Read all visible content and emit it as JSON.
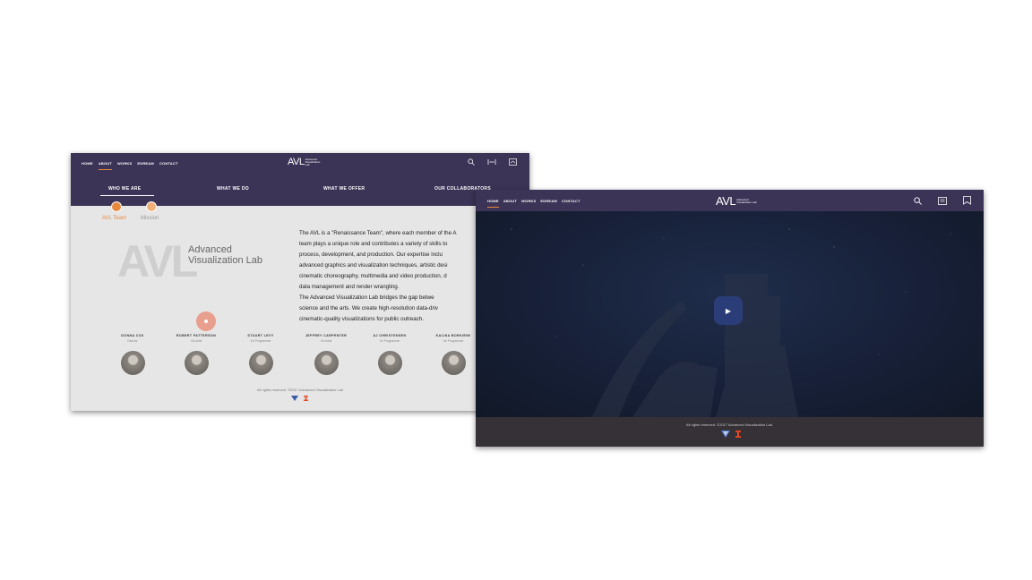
{
  "left_window": {
    "nav": {
      "items": [
        "HOME",
        "ABOUT",
        "WORKS",
        "EDREAM",
        "CONTACT"
      ],
      "active": "ABOUT"
    },
    "logo": {
      "mark": "AVL",
      "subtitle": "Advanced\nVisualization\nLab"
    },
    "subnav": [
      "WHO WE ARE",
      "WHAT WE DO",
      "WHAT WE OFFER",
      "OUR COLLABORATORS"
    ],
    "tabs": {
      "active": "AVL Team",
      "inactive": "Mission"
    },
    "avl_big": "AVL",
    "avl_name_line1": "Advanced",
    "avl_name_line2": "Visualization Lab",
    "description": "The AVL is a \"Renaissance Team\", where each member of the A\nteam plays a unique role and contributes a variety of skills to\nprocess, development, and production.  Our expertise inclu\nadvanced graphics and visualization techniques, artistic desi\ncinematic choreography, multimedia and video production, d\ndata management and render wrangling.\nThe Advanced Visualization Lab bridges the gap betwe\nscience and the arts. We create high-resolution data-driv\ncinematic-quality visualizations for public outreach.",
    "team": [
      {
        "name": "DONNA COX",
        "role": "Director"
      },
      {
        "name": "ROBERT PATTERSON",
        "role": "Viz Artist"
      },
      {
        "name": "STUART LEVY",
        "role": "Viz Programmer"
      },
      {
        "name": "JEFFREY CARPENTER",
        "role": "Viz Artist"
      },
      {
        "name": "AJ CHRISTENSEN",
        "role": "Viz Programmer"
      },
      {
        "name": "KALINA BORKIEWI",
        "role": "Viz Programmer"
      }
    ],
    "footer": "All rights reserved. ©2017 Advanced Visualization Lab"
  },
  "right_window": {
    "nav": {
      "items": [
        "HOME",
        "ABOUT",
        "WORKS",
        "EDREAM",
        "CONTACT"
      ],
      "active": "HOME"
    },
    "logo": {
      "mark": "AVL",
      "subtitle": "Advanced\nVisualization Lab"
    },
    "play_icon": "▶",
    "footer": "All rights reserved. ©2017 Advanced Visualization Lab."
  },
  "colors": {
    "nav_bg": "#3b3456",
    "accent": "#e8893e",
    "play_bg": "#2b3d78",
    "footer_bg": "#353136"
  }
}
